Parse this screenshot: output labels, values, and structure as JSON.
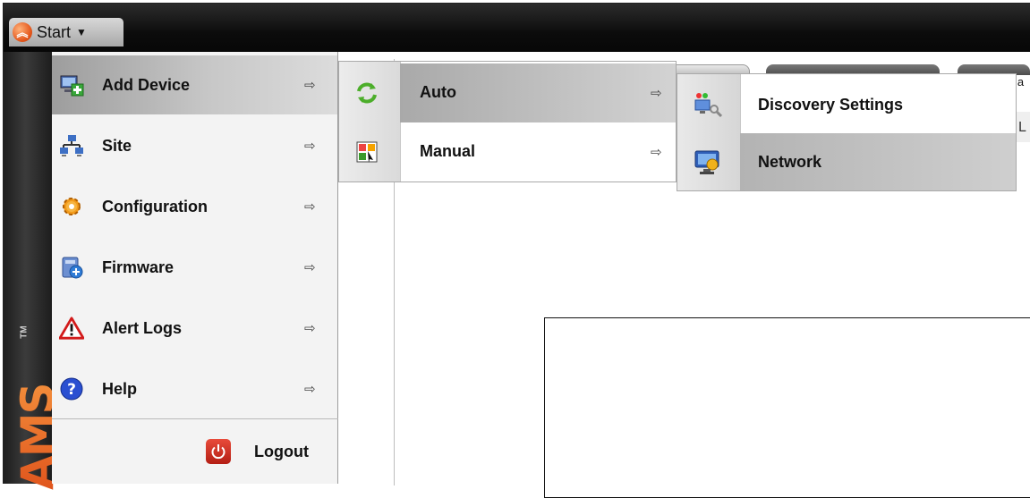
{
  "taskbar": {
    "start_label": "Start",
    "start_icon": "ams-logo-icon",
    "caret_icon": "caret-down-icon"
  },
  "brand": {
    "name": "AMS",
    "trademark": "TM"
  },
  "start_menu": {
    "items": [
      {
        "label": "Add Device",
        "icon": "add-device-icon",
        "active": true
      },
      {
        "label": "Site",
        "icon": "site-network-icon"
      },
      {
        "label": "Configuration",
        "icon": "configuration-gear-icon"
      },
      {
        "label": "Firmware",
        "icon": "firmware-icon"
      },
      {
        "label": "Alert Logs",
        "icon": "alert-warning-icon"
      },
      {
        "label": "Help",
        "icon": "help-icon"
      }
    ],
    "logout_label": "Logout"
  },
  "add_device_submenu": {
    "items": [
      {
        "label": "Auto",
        "icon": "auto-refresh-icon",
        "active": true
      },
      {
        "label": "Manual",
        "icon": "manual-icon"
      }
    ]
  },
  "auto_submenu": {
    "items": [
      {
        "label": "Discovery Settings",
        "icon": "discovery-settings-icon"
      },
      {
        "label": "Network",
        "icon": "network-computer-icon",
        "active": true
      }
    ]
  },
  "background": {
    "tab_text": "la",
    "edge_text": "L"
  }
}
